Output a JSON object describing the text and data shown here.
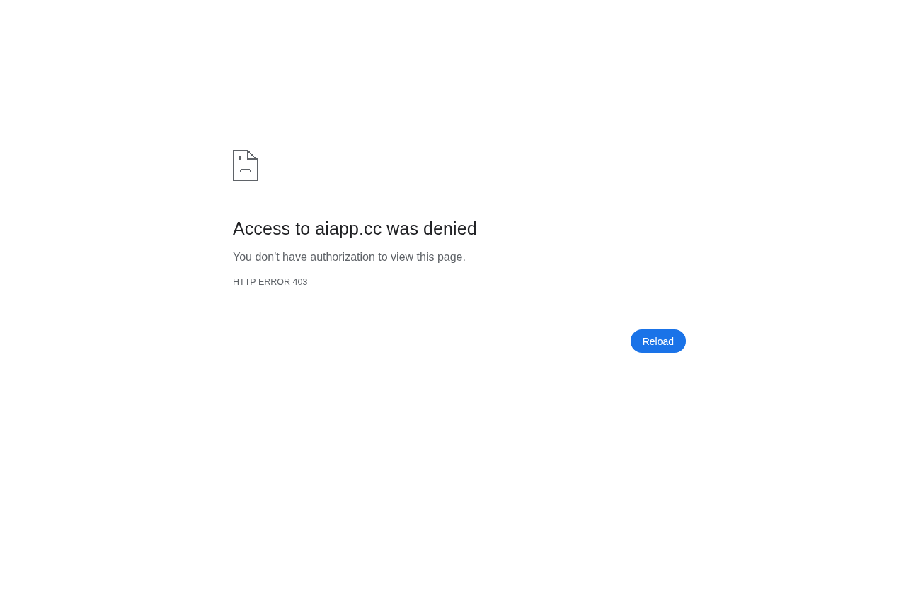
{
  "heading": "Access to aiapp.cc was denied",
  "message": "You don't have authorization to view this page.",
  "error_code": "HTTP ERROR 403",
  "reload_button": {
    "label": "Reload"
  }
}
